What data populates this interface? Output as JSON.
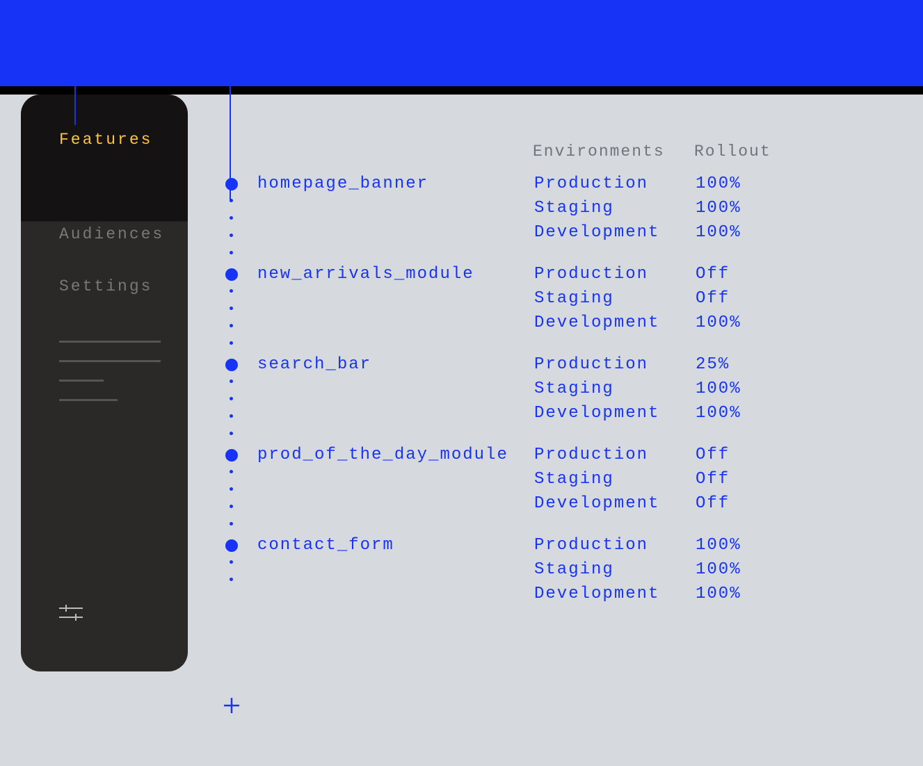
{
  "sidebar": {
    "active_label": "Features",
    "items": [
      "Audiences",
      "Settings"
    ]
  },
  "headers": {
    "environments": "Environments",
    "rollout": "Rollout"
  },
  "features": [
    {
      "name": "homepage_banner",
      "envs": [
        "Production",
        "Staging",
        "Development"
      ],
      "rollouts": [
        "100%",
        "100%",
        "100%"
      ]
    },
    {
      "name": "new_arrivals_module",
      "envs": [
        "Production",
        "Staging",
        "Development"
      ],
      "rollouts": [
        "Off",
        "Off",
        "100%"
      ]
    },
    {
      "name": "search_bar",
      "envs": [
        "Production",
        "Staging",
        "Development"
      ],
      "rollouts": [
        "25%",
        "100%",
        "100%"
      ]
    },
    {
      "name": "prod_of_the_day_module",
      "envs": [
        "Production",
        "Staging",
        "Development"
      ],
      "rollouts": [
        "Off",
        "Off",
        "Off"
      ]
    },
    {
      "name": "contact_form",
      "envs": [
        "Production",
        "Staging",
        "Development"
      ],
      "rollouts": [
        "100%",
        "100%",
        "100%"
      ]
    }
  ]
}
